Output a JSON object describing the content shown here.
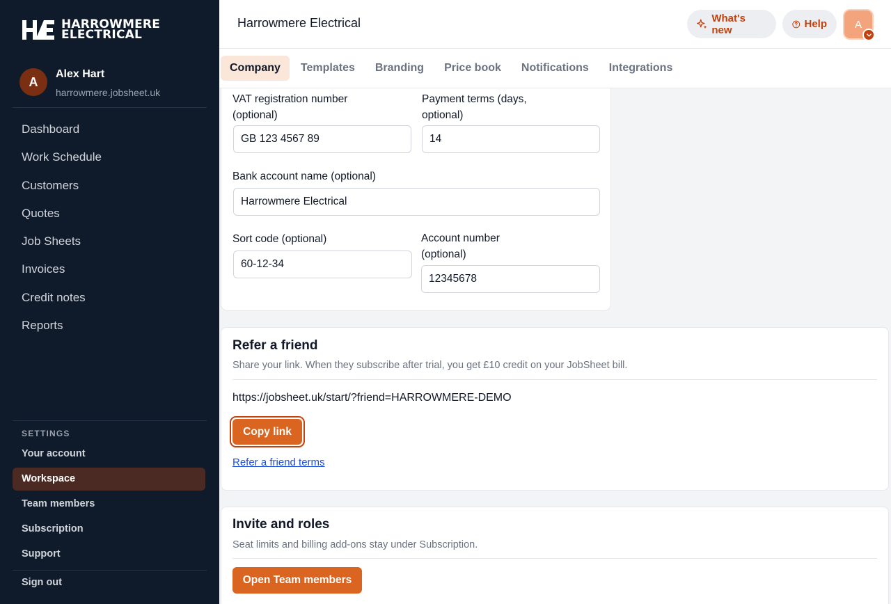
{
  "brand": {
    "logo_line1": "HARROWMERE",
    "logo_line2": "ELECTRICAL",
    "accent": "#d96520"
  },
  "user": {
    "initial": "A",
    "name": "Alex Hart",
    "domain": "harrowmere.jobsheet.uk"
  },
  "nav": [
    "Dashboard",
    "Work Schedule",
    "Customers",
    "Quotes",
    "Job Sheets",
    "Invoices",
    "Credit notes",
    "Reports"
  ],
  "settings": {
    "label": "SETTINGS",
    "items": [
      "Your account",
      "Workspace",
      "Team members",
      "Subscription",
      "Support"
    ],
    "active": "Workspace"
  },
  "sign_out": "Sign out",
  "header": {
    "title": "Harrowmere Electrical",
    "whats_new": "What's new",
    "help": "Help",
    "avatar_initial": "A"
  },
  "tabs": [
    "Company",
    "Templates",
    "Branding",
    "Price book",
    "Notifications",
    "Integrations"
  ],
  "company_form": {
    "vat_label_1": "VAT registration number",
    "vat_label_2": "(optional)",
    "vat_value": "GB 123 4567 89",
    "terms_label_1": "Payment terms (days,",
    "terms_label_2": "optional)",
    "terms_value": "14",
    "bank_name_label": "Bank account name (optional)",
    "bank_name_value": "Harrowmere Electrical",
    "sort_label": "Sort code (optional)",
    "sort_value": "60-12-34",
    "account_label_1": "Account number",
    "account_label_2": "(optional)",
    "account_value": "12345678"
  },
  "refer": {
    "title": "Refer a friend",
    "subtitle": "Share your link. When they subscribe after trial, you get £10 credit on your JobSheet bill.",
    "link": "https://jobsheet.uk/start/?friend=HARROWMERE-DEMO",
    "copy_button": "Copy link",
    "terms_link": "Refer a friend terms"
  },
  "invite": {
    "title": "Invite and roles",
    "subtitle": "Seat limits and billing add-ons stay under Subscription.",
    "button": "Open Team members"
  }
}
